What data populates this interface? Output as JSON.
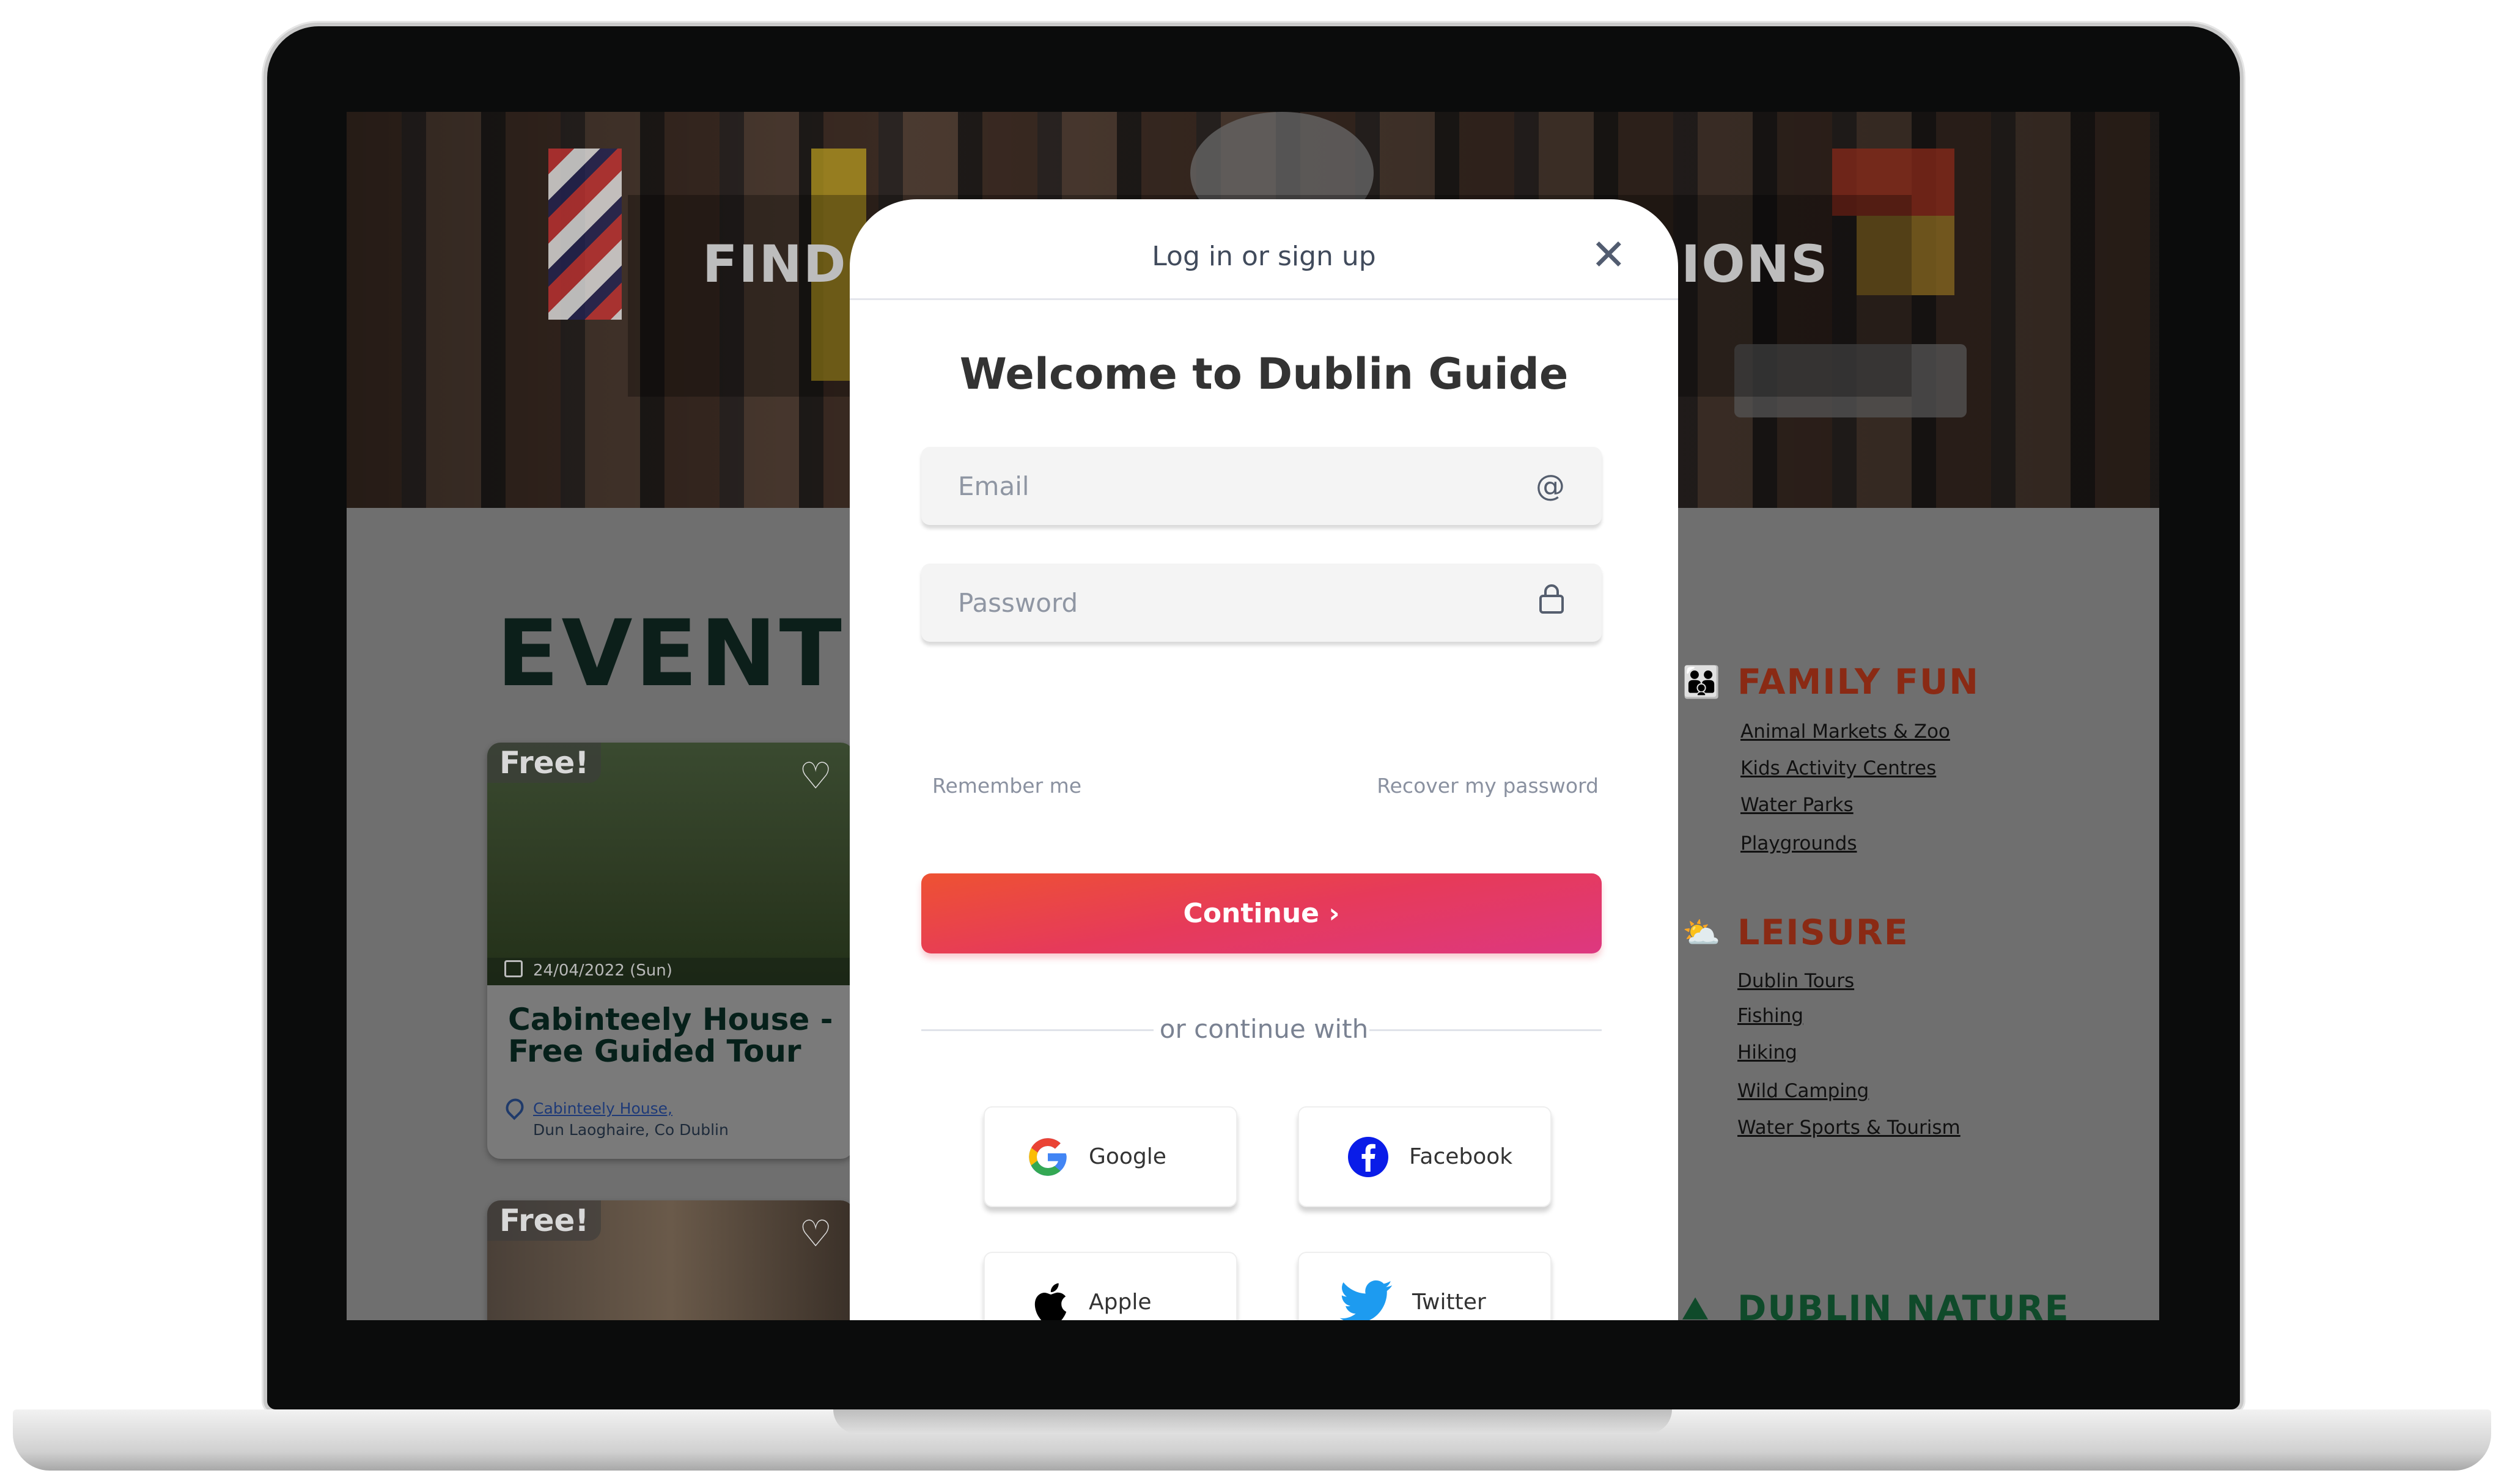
{
  "hero": {
    "title_left": "FIND E",
    "title_right": "IONS"
  },
  "events": {
    "title": "EVENTS",
    "cards": [
      {
        "badge": "Free!",
        "date": "24/04/2022 (Sun)",
        "title": "Cabinteely House - Free Guided Tour",
        "venue": "Cabinteely House,",
        "address": "Dun Laoghaire, Co Dublin"
      },
      {
        "badge": "Free!"
      }
    ]
  },
  "categories": [
    {
      "title": "FAMILY FUN",
      "icon": "family-icon",
      "color": "#8a2a14",
      "links": [
        "Animal Markets & Zoo",
        "Kids Activity Centres",
        "Water Parks",
        "Playgrounds"
      ]
    },
    {
      "title": "LEISURE",
      "icon": "sun-cloud-icon",
      "color": "#8a2a14",
      "links": [
        "Dublin Tours",
        "Fishing",
        "Hiking",
        "Wild Camping",
        "Water Sports & Tourism"
      ]
    },
    {
      "title": "DUBLIN NATURE",
      "icon": "mountain-icon",
      "color": "#0f4a2a"
    }
  ],
  "modal": {
    "header": "Log in or sign up",
    "close_icon": "close-icon",
    "welcome": "Welcome to Dublin Guide",
    "email_placeholder": "Email",
    "password_placeholder": "Password",
    "remember": "Remember me",
    "recover": "Recover my password",
    "continue": "Continue",
    "divider": "or continue with",
    "social": [
      {
        "label": "Google",
        "icon": "google-icon"
      },
      {
        "label": "Facebook",
        "icon": "facebook-icon"
      },
      {
        "label": "Apple",
        "icon": "apple-icon"
      },
      {
        "label": "Twitter",
        "icon": "twitter-icon"
      }
    ],
    "accent": "#e63a5a"
  }
}
